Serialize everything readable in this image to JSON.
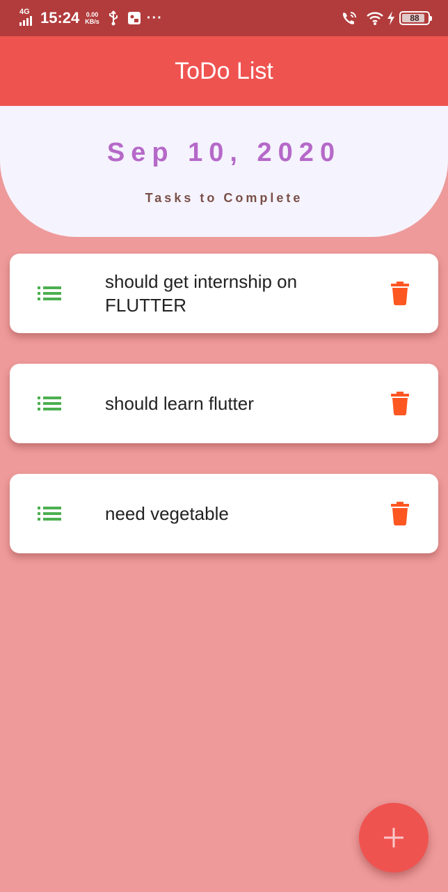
{
  "status_bar": {
    "network": "4G",
    "time": "15:24",
    "speed_value": "0.00",
    "speed_unit": "KB/s",
    "overflow": "···",
    "battery_level": "88",
    "battery_percent": 88,
    "icons": [
      "signal-icon",
      "usb-icon",
      "notification-icon",
      "wifi-calling-icon",
      "wifi-icon",
      "charging-icon",
      "battery-icon"
    ]
  },
  "app_bar": {
    "title": "ToDo List",
    "color": "#ef5350"
  },
  "header": {
    "date": "Sep 10, 2020",
    "subtitle": "Tasks to Complete",
    "date_color": "#b569c8",
    "subtitle_color": "#7a5048",
    "background": "#f5f3fe"
  },
  "tasks": [
    {
      "text": "should get internship on FLUTTER",
      "leading_icon": "list-icon",
      "trailing_icon": "trash-icon"
    },
    {
      "text": "should learn flutter",
      "leading_icon": "list-icon",
      "trailing_icon": "trash-icon"
    },
    {
      "text": "need vegetable",
      "leading_icon": "list-icon",
      "trailing_icon": "trash-icon"
    }
  ],
  "fab": {
    "icon": "plus-icon",
    "color": "#ef5350"
  },
  "colors": {
    "background": "#ee9a9a",
    "list_icon": "#4caf50",
    "delete_icon": "#ff5722",
    "status_bar": "#b23c3c"
  }
}
